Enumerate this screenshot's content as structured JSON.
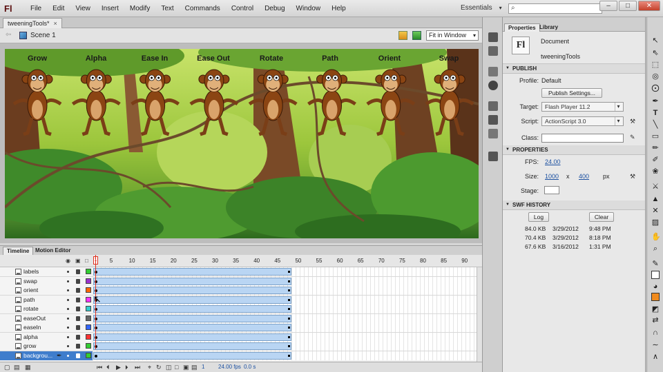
{
  "app": {
    "logo": "Fl",
    "menu": [
      "File",
      "Edit",
      "View",
      "Insert",
      "Modify",
      "Text",
      "Commands",
      "Control",
      "Debug",
      "Window",
      "Help"
    ],
    "workspace": "Essentials",
    "window_buttons": [
      "–",
      "□",
      "✕"
    ]
  },
  "document_tab": {
    "name": "tweeningTools*",
    "close": "×"
  },
  "editbar": {
    "scene": "Scene 1",
    "zoom": "Fit in Window"
  },
  "stage": {
    "labels": [
      "Grow",
      "Alpha",
      "Ease In",
      "Ease Out",
      "Rotate",
      "Path",
      "Orient",
      "Swap"
    ]
  },
  "timeline": {
    "tabs": [
      "Timeline",
      "Motion Editor"
    ],
    "frame_numbers": [
      "5",
      "10",
      "15",
      "20",
      "25",
      "30",
      "35",
      "40",
      "45",
      "50",
      "55",
      "60",
      "65",
      "70",
      "75",
      "80",
      "85",
      "90"
    ],
    "playhead_frame": "1",
    "layers": [
      {
        "name": "labels",
        "color": "#33cc33"
      },
      {
        "name": "swap",
        "color": "#9933cc"
      },
      {
        "name": "orient",
        "color": "#ff6600"
      },
      {
        "name": "path",
        "color": "#ff33ff"
      },
      {
        "name": "rotate",
        "color": "#33cccc"
      },
      {
        "name": "easeOut",
        "color": "#666666"
      },
      {
        "name": "easeIn",
        "color": "#3366ff"
      },
      {
        "name": "alpha",
        "color": "#ff3333"
      },
      {
        "name": "grow",
        "color": "#33cc33"
      },
      {
        "name": "backgrou...",
        "color": "#33cc33"
      }
    ],
    "footer": {
      "current_frame": "1",
      "fps": "24.00 fps",
      "time": "0.0 s"
    }
  },
  "properties": {
    "tabs": [
      "Properties",
      "Library"
    ],
    "doc_type": "Document",
    "doc_name": "tweeningTools",
    "publish": {
      "header": "PUBLISH",
      "profile_label": "Profile:",
      "profile_value": "Default",
      "settings_button": "Publish Settings...",
      "target_label": "Target:",
      "target_value": "Flash Player 11.2",
      "script_label": "Script:",
      "script_value": "ActionScript 3.0",
      "class_label": "Class:"
    },
    "props": {
      "header": "PROPERTIES",
      "fps_label": "FPS:",
      "fps_value": "24.00",
      "size_label": "Size:",
      "width": "1000",
      "x": "x",
      "height": "400",
      "unit": "px",
      "stage_label": "Stage:"
    },
    "history": {
      "header": "SWF HISTORY",
      "log_button": "Log",
      "clear_button": "Clear",
      "rows": [
        [
          "84.0 KB",
          "3/29/2012",
          "9:48 PM"
        ],
        [
          "70.4 KB",
          "3/29/2012",
          "8:18 PM"
        ],
        [
          "67.6 KB",
          "3/16/2012",
          "1:31 PM"
        ]
      ]
    }
  },
  "colors": {
    "accent": "#3f7dcc",
    "tween_span": "#b9d5f3",
    "playhead": "#e0301e"
  }
}
